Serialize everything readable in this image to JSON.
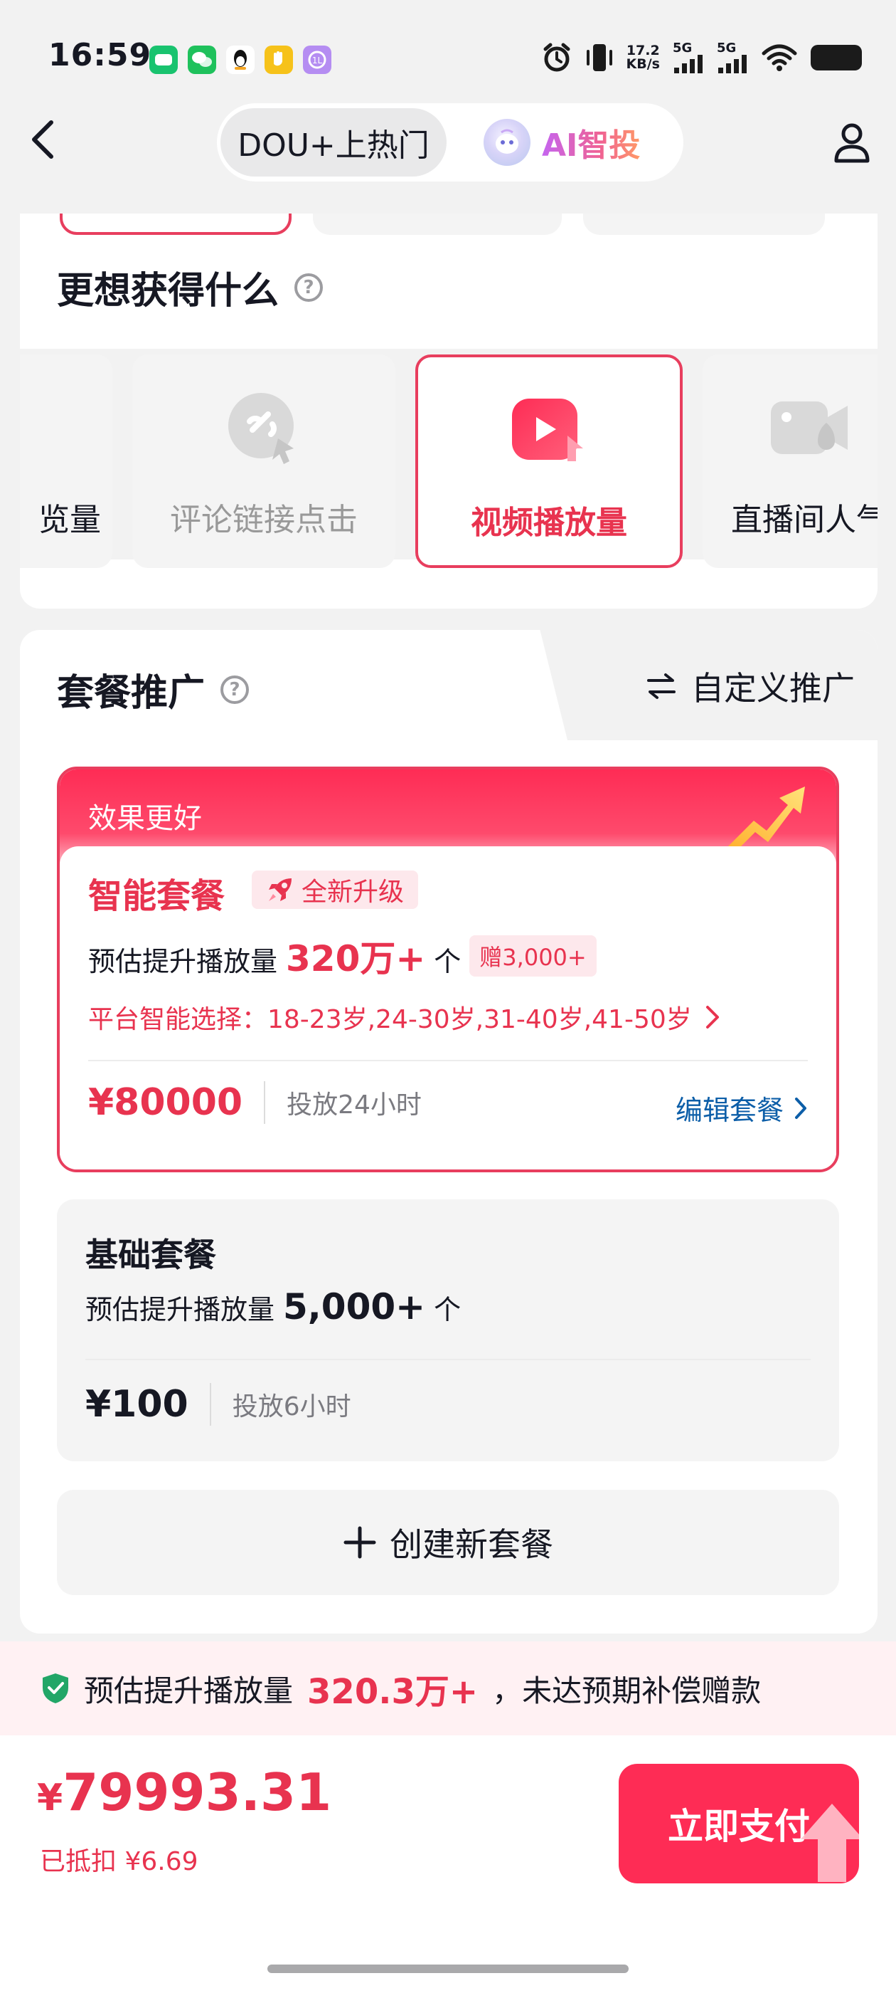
{
  "status_bar": {
    "time": "16:59",
    "net_speed_value": "17.2",
    "net_speed_unit": "KB/s",
    "sim1": "5G",
    "sim2": "5G"
  },
  "nav": {
    "tab_dou": "DOU+上热门",
    "tab_ai": "AI智投"
  },
  "goal": {
    "title": "更想获得什么",
    "options": [
      {
        "label": "览量",
        "icon": "eye-icon",
        "state": "normal"
      },
      {
        "label": "评论链接点击",
        "icon": "link-click-icon",
        "state": "disabled"
      },
      {
        "label": "视频播放量",
        "icon": "video-play-icon",
        "state": "selected"
      },
      {
        "label": "直播间人气",
        "icon": "live-camera-icon",
        "state": "normal"
      }
    ]
  },
  "package": {
    "title": "套餐推广",
    "custom_tab": "自定义推广",
    "smart": {
      "header": "效果更好",
      "name": "智能套餐",
      "badge": "全新升级",
      "est_label": "预估提升播放量",
      "est_value": "320万+",
      "est_unit": "个",
      "gift": "赠3,000+",
      "platform": "平台智能选择：18-23岁,24-30岁,31-40岁,41-50岁",
      "price": "¥80000",
      "duration": "投放24小时",
      "edit": "编辑套餐"
    },
    "basic": {
      "name": "基础套餐",
      "est_label": "预估提升播放量",
      "est_value": "5,000+",
      "est_unit": "个",
      "price": "¥100",
      "duration": "投放6小时"
    },
    "create": "创建新套餐"
  },
  "guarantee": {
    "label": "预估提升播放量",
    "value": "320.3万+",
    "tail": "，未达预期补偿赠款"
  },
  "checkout": {
    "currency": "¥",
    "total": "79993.31",
    "deduct": "已抵扣 ¥6.69",
    "pay": "立即支付"
  },
  "colors": {
    "accent": "#fe2c55",
    "accent_text": "#e8334f",
    "link": "#0c5ea8",
    "guarantee_bg": "#fff1f3"
  }
}
